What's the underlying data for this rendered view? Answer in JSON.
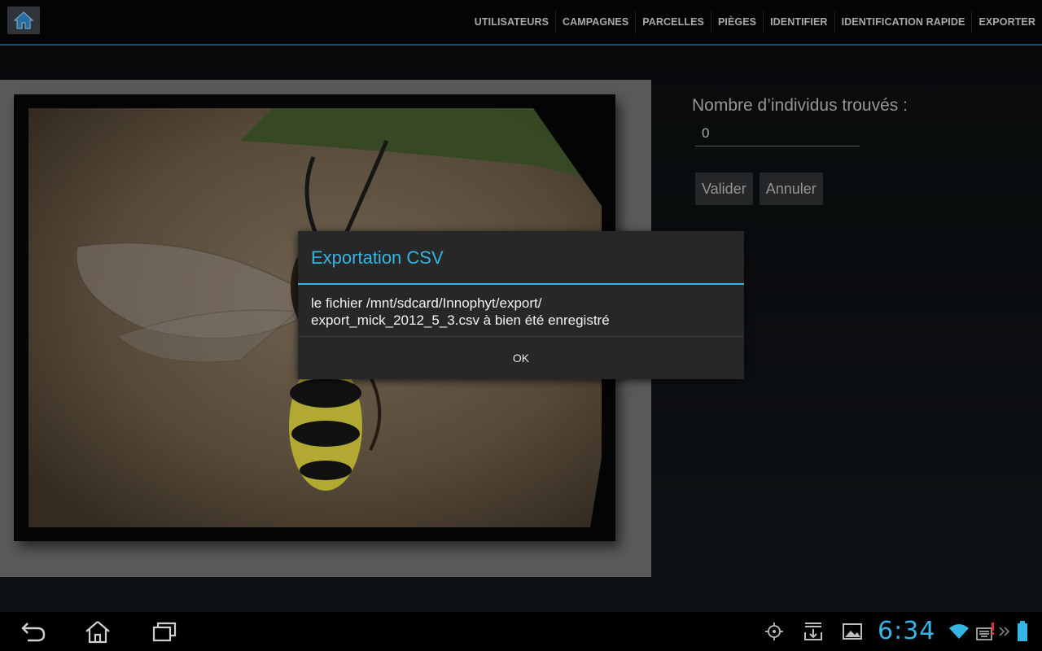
{
  "action_bar": {
    "home_icon": "home-icon",
    "tabs": [
      "UTILISATEURS",
      "CAMPAGNES",
      "PARCELLES",
      "PIÈGES",
      "IDENTIFIER",
      "IDENTIFICATION RAPIDE",
      "EXPORTER"
    ]
  },
  "identification": {
    "count_label": "Nombre d’individus trouvés :",
    "count_value": "0",
    "validate_label": "Valider",
    "cancel_label": "Annuler"
  },
  "dialog": {
    "title": "Exportation CSV",
    "message_line1": "le fichier /mnt/sdcard/Innophyt/export/",
    "message_line2": "export_mick_2012_5_3.csv à bien été enregistré",
    "ok_label": "OK"
  },
  "system_bar": {
    "time": "6:34",
    "accent": "#33b5e5"
  }
}
